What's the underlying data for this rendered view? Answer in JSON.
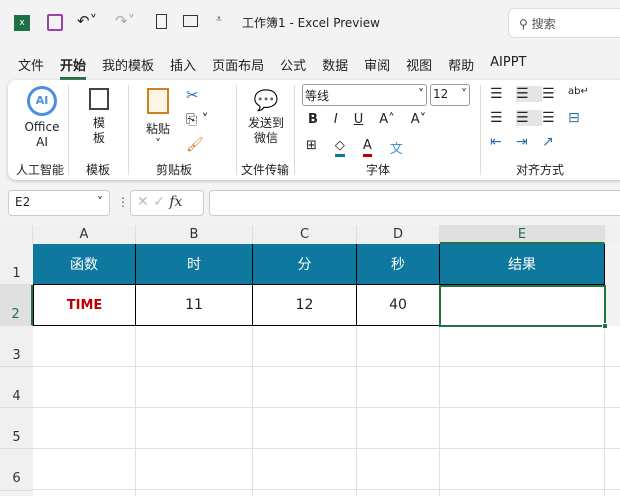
{
  "titlebar": {
    "title": "工作簿1  -  Excel Preview",
    "search": "搜索"
  },
  "menu": [
    "文件",
    "开始",
    "我的模板",
    "插入",
    "页面布局",
    "公式",
    "数据",
    "审阅",
    "视图",
    "帮助",
    "AIPPT"
  ],
  "ribbon": {
    "office_ai": "Office AI",
    "template": "模板",
    "paste": "粘贴",
    "send": "发送到微信",
    "font_name": "等线",
    "font_size": "12",
    "groups": [
      "人工智能",
      "模板",
      "剪贴板",
      "文件传输",
      "字体",
      "对齐方式"
    ]
  },
  "formula_bar": {
    "name_box": "E2",
    "fx": "fx",
    "value": ""
  },
  "columns": [
    "A",
    "B",
    "C",
    "D",
    "E"
  ],
  "rows": [
    "1",
    "2",
    "3",
    "4",
    "5",
    "6"
  ],
  "table": {
    "headers": [
      "函数",
      "时",
      "分",
      "秒",
      "结果"
    ],
    "row": [
      "TIME",
      "11",
      "12",
      "40",
      ""
    ]
  },
  "colors": {
    "header_bg": "#0f789f",
    "func_text": "#c00000",
    "selection": "#217346"
  }
}
